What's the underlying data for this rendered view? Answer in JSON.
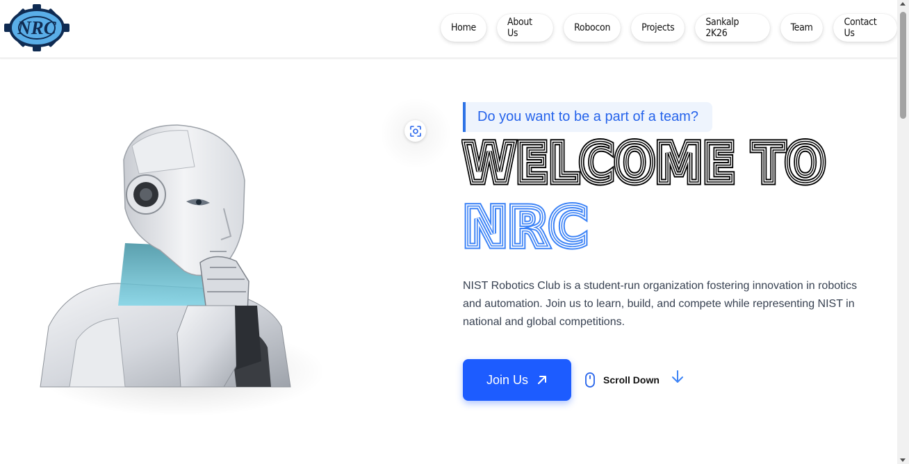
{
  "brand": {
    "logo_text": "NRC"
  },
  "nav": {
    "items": [
      {
        "label": "Home"
      },
      {
        "label": "About Us"
      },
      {
        "label": "Robocon"
      },
      {
        "label": "Projects"
      },
      {
        "label": "Sankalp 2K26"
      },
      {
        "label": "Team"
      },
      {
        "label": "Contact Us"
      }
    ]
  },
  "hero": {
    "tagline": "Do you want to be a part of a team?",
    "heading_line1": "WELCOME TO",
    "heading_line2": "NRC",
    "description": "NIST Robotics Club is a student-run organization fostering innovation in robotics and automation. Join us to learn, build, and compete while representing NIST in national and global competitions.",
    "join_label": "Join Us",
    "scroll_label": "Scroll Down"
  },
  "icons": {
    "join": "arrow-up-right-icon",
    "mouse": "mouse-icon",
    "scroll": "arrow-down-icon",
    "focus": "focus-scan-icon"
  },
  "colors": {
    "accent": "#1d5cff",
    "tagline_text": "#2563eb",
    "tagline_bg": "#eef4fd",
    "heading_dark": "#000000",
    "heading_blue": "#3b82f6",
    "logo_gear": "#0f2b52",
    "logo_fill": "#5aaee8"
  }
}
